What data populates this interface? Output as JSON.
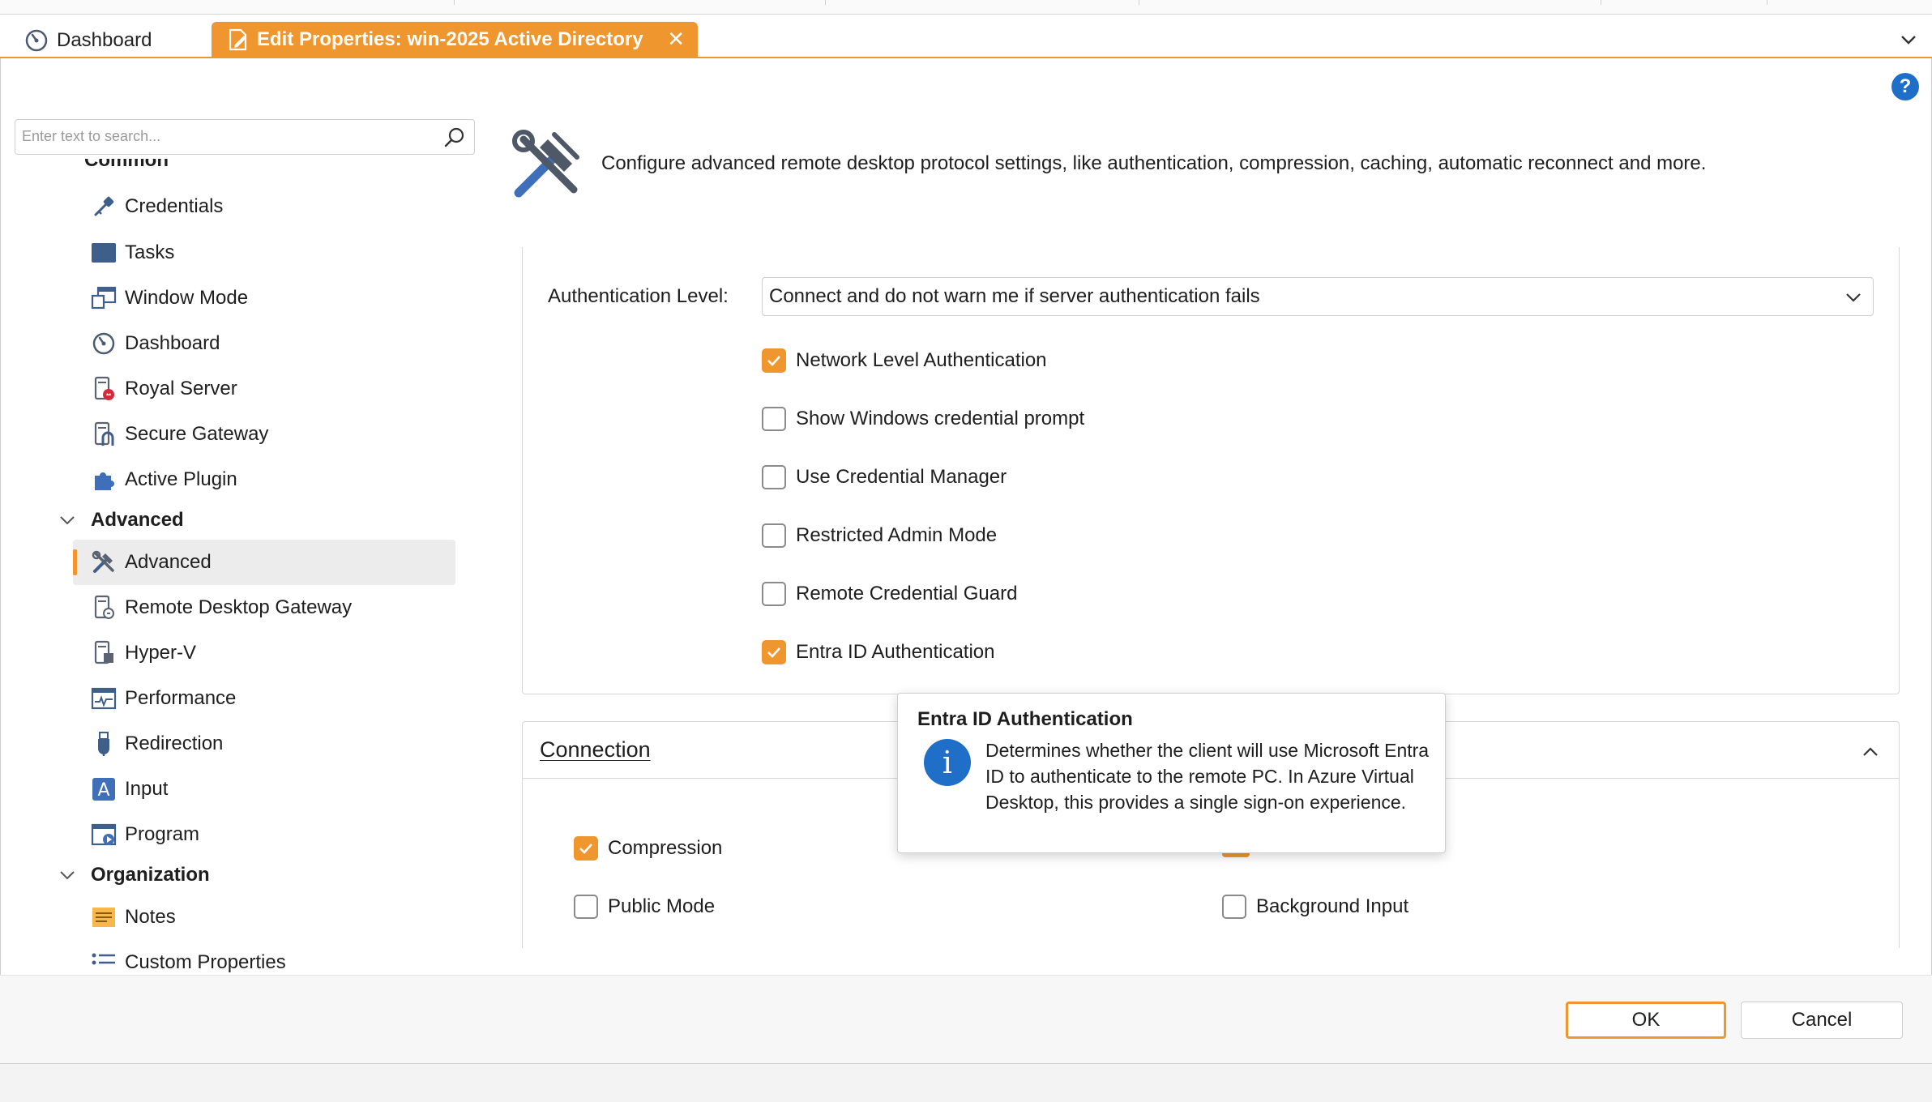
{
  "tabs": {
    "dashboard_label": "Dashboard",
    "edit_label": "Edit Properties: win-2025 Active Directory",
    "close_glyph": "✕"
  },
  "help_glyph": "?",
  "search": {
    "placeholder": "Enter text to search..."
  },
  "tree": {
    "partial_group": "Common",
    "common_items": [
      {
        "label": "Credentials",
        "icon": "key-icon"
      },
      {
        "label": "Tasks",
        "icon": "tasks-icon"
      },
      {
        "label": "Window Mode",
        "icon": "window-mode-icon"
      },
      {
        "label": "Dashboard",
        "icon": "dashboard-icon"
      },
      {
        "label": "Royal Server",
        "icon": "royal-server-icon"
      },
      {
        "label": "Secure Gateway",
        "icon": "secure-gateway-icon"
      },
      {
        "label": "Active Plugin",
        "icon": "plugin-icon"
      }
    ],
    "advanced_group": "Advanced",
    "advanced_items": [
      {
        "label": "Advanced",
        "icon": "tools-icon",
        "selected": true
      },
      {
        "label": "Remote Desktop Gateway",
        "icon": "rd-gateway-icon"
      },
      {
        "label": "Hyper-V",
        "icon": "hyper-v-icon"
      },
      {
        "label": "Performance",
        "icon": "performance-icon"
      },
      {
        "label": "Redirection",
        "icon": "redirection-icon"
      },
      {
        "label": "Input",
        "icon": "input-icon"
      },
      {
        "label": "Program",
        "icon": "program-icon"
      }
    ],
    "organization_group": "Organization",
    "organization_items": [
      {
        "label": "Notes",
        "icon": "notes-icon"
      },
      {
        "label": "Custom Properties",
        "icon": "custom-properties-icon"
      }
    ]
  },
  "header": {
    "description": "Configure advanced remote desktop protocol settings, like authentication, compression, caching, automatic reconnect and more."
  },
  "security": {
    "auth_level_label": "Authentication Level:",
    "auth_level_value": "Connect and do not warn me if server authentication fails",
    "options": [
      {
        "label": "Network Level Authentication",
        "checked": true
      },
      {
        "label": "Show Windows credential prompt",
        "checked": false
      },
      {
        "label": "Use Credential Manager",
        "checked": false
      },
      {
        "label": "Restricted Admin Mode",
        "checked": false
      },
      {
        "label": "Remote Credential Guard",
        "checked": false
      },
      {
        "label": "Entra ID Authentication",
        "checked": true
      }
    ]
  },
  "connection": {
    "title": "Connection",
    "options": [
      {
        "label": "Compression",
        "checked": true
      },
      {
        "label": "Public Mode",
        "checked": false
      },
      {
        "label": "Background Input",
        "checked": false
      }
    ]
  },
  "tooltip": {
    "title": "Entra ID Authentication",
    "text": "Determines whether the client will use Microsoft Entra ID to authenticate to the remote PC. In Azure Virtual Desktop, this provides a single sign-on experience."
  },
  "footer": {
    "ok_label": "OK",
    "cancel_label": "Cancel"
  },
  "colors": {
    "accent": "#f0962e",
    "info_blue": "#1f6fc9"
  }
}
